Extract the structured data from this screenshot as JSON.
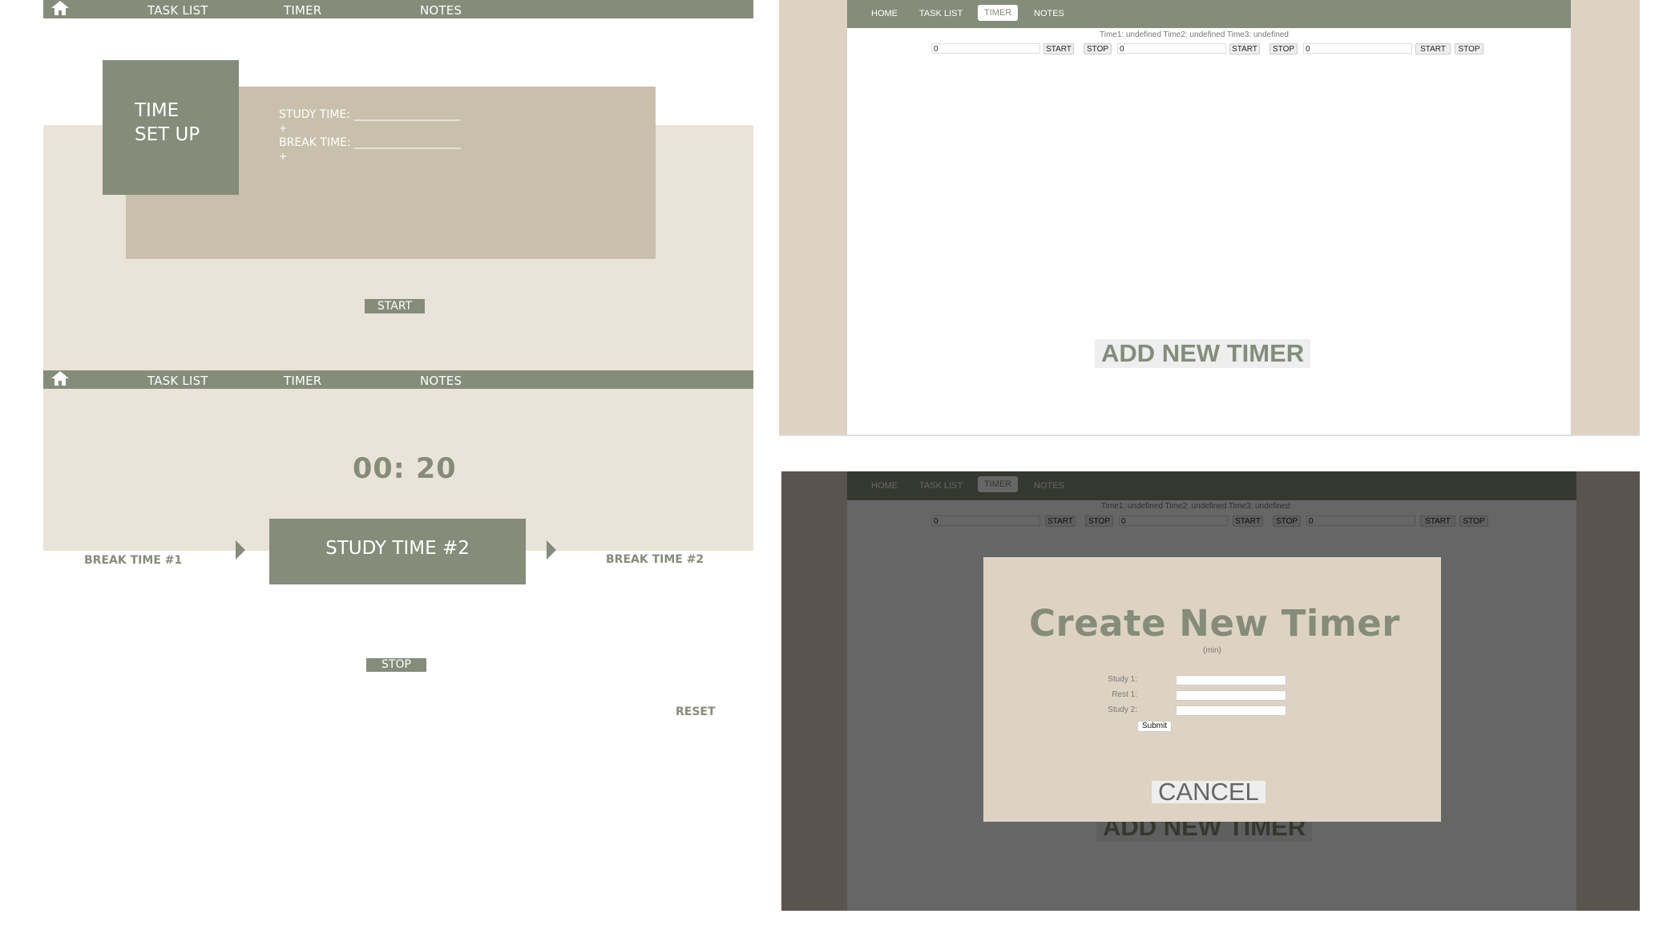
{
  "mockup_nav": {
    "task_list": "TASK LIST",
    "timer": "TIMER",
    "notes": "NOTES"
  },
  "setup": {
    "title": "TIME\nSET UP",
    "study_time_line": "STUDY TIME: ___________________",
    "plus1": "+",
    "break_time_line": "BREAK TIME: ___________________",
    "plus2": "+",
    "start_label": "START"
  },
  "running": {
    "time": "00: 20",
    "prev_label": "BREAK TIME #1",
    "current_label": "STUDY TIME #2",
    "next_label": "BREAK TIME #2",
    "stop_label": "STOP",
    "reset_label": "RESET"
  },
  "browser_nav": {
    "home": "HOME",
    "task_list": "TASK LIST",
    "timer": "TIMER",
    "notes": "NOTES"
  },
  "timer_page": {
    "times_line": "Time1:  undefined Time2:  undefined Time3:  undefined",
    "input_value": "0",
    "start_label": "START",
    "stop_label": "STOP",
    "add_new_timer": "ADD NEW TIMER"
  },
  "modal": {
    "title": "Create New Timer",
    "unit": "(min)",
    "study1_label": "Study 1:",
    "rest1_label": "Rest 1:",
    "study2_label": "Study 2:",
    "submit_label": "Submit",
    "cancel_label": "CANCEL"
  },
  "colors": {
    "sage": "#858c7a",
    "cream": "#eae3d8",
    "tan": "#c8c0ab",
    "browser_frame": "#ded3c3"
  }
}
